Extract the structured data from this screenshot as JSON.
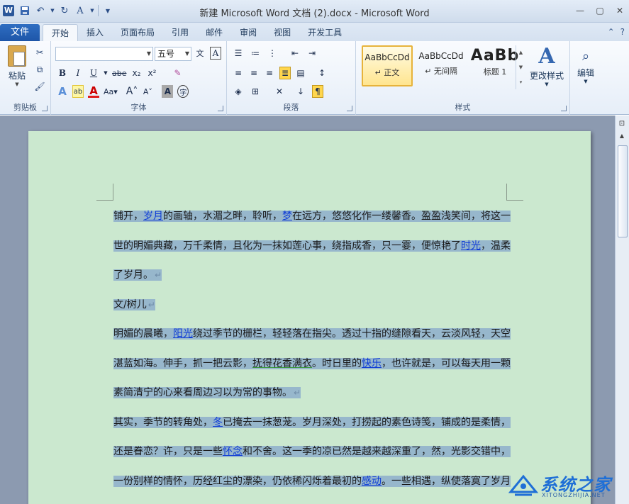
{
  "titlebar": {
    "title": "新建 Microsoft Word 文档 (2).docx - Microsoft Word",
    "logo_letter": "W"
  },
  "tabs": {
    "file": "文件",
    "items": [
      "开始",
      "插入",
      "页面布局",
      "引用",
      "邮件",
      "审阅",
      "视图",
      "开发工具"
    ],
    "active": "开始"
  },
  "ribbon": {
    "clipboard": {
      "label": "剪贴板",
      "paste": "粘贴"
    },
    "font": {
      "label": "字体",
      "font_name": "",
      "font_size": "五号",
      "buttons": [
        "B",
        "I",
        "U",
        "abe",
        "x₂",
        "x²"
      ]
    },
    "paragraph": {
      "label": "段落"
    },
    "styles": {
      "label": "样式",
      "items": [
        {
          "sample": "AaBbCcDd",
          "name": "↵ 正文",
          "selected": true
        },
        {
          "sample": "AaBbCcDd",
          "name": "↵ 无间隔",
          "selected": false
        },
        {
          "sample": "AaBb",
          "name": "标题 1",
          "selected": false
        }
      ],
      "change_styles": "更改样式"
    },
    "editing": {
      "label": "编辑"
    }
  },
  "document": {
    "lines": [
      {
        "segments": [
          {
            "t": "铺开，"
          },
          {
            "t": "岁月",
            "link": true
          },
          {
            "t": "的画轴，水湄之畔，聆听，"
          },
          {
            "t": "梦",
            "link": true
          },
          {
            "t": "在远方，悠悠化作一缕馨香。盈盈浅笑间，将这一"
          }
        ],
        "mark": false
      },
      {
        "segments": [
          {
            "t": "世的明媚典藏，万千柔情，且化为一抹如莲心事，绕指成香，只一霎，便惊艳了"
          },
          {
            "t": "时光",
            "link": true
          },
          {
            "t": "，温柔"
          }
        ],
        "mark": false
      },
      {
        "segments": [
          {
            "t": "了岁月。"
          }
        ],
        "mark": true
      },
      {
        "segments": [
          {
            "t": "文/树儿"
          }
        ],
        "mark": true
      },
      {
        "segments": [
          {
            "t": "明媚的晨曦，"
          },
          {
            "t": "阳光",
            "link": true
          },
          {
            "t": "绕过季节的栅栏，轻轻落在指尖。透过十指的缝隙看天，云淡风轻，天空"
          }
        ],
        "mark": false
      },
      {
        "segments": [
          {
            "t": "湛蓝如海。伸手，抓一把云影，"
          },
          {
            "t": "抚得花香满衣",
            "green": true
          },
          {
            "t": "。时日里的"
          },
          {
            "t": "快乐",
            "link": true
          },
          {
            "t": "，也许就是，可以每天用一颗"
          }
        ],
        "mark": false
      },
      {
        "segments": [
          {
            "t": "素简清宁的心来看周边习以为常的事物。"
          }
        ],
        "mark": true
      },
      {
        "segments": [
          {
            "t": "其实，季节的转角处，"
          },
          {
            "t": "冬",
            "link": true
          },
          {
            "t": "已掩去一抹葱茏。岁月深处，打捞起的素色诗笺，铺成的是柔情，"
          }
        ],
        "mark": false
      },
      {
        "segments": [
          {
            "t": "还是眷恋？许，只是一些"
          },
          {
            "t": "怀念",
            "link": true
          },
          {
            "t": "和不舍。这一季的凉已然是越来越深重了，然，光影交错中，"
          }
        ],
        "mark": false
      },
      {
        "segments": [
          {
            "t": "一份别样的情怀，历经红尘的漂染，仍依稀闪烁着最初的"
          },
          {
            "t": "感动",
            "link": true
          },
          {
            "t": "。一些相遇，纵使落寞了岁月"
          }
        ],
        "mark": false
      }
    ]
  },
  "watermark": {
    "main": "系统之家",
    "sub": "XITONGZHIJIA.NET"
  },
  "colors": {
    "page": "#cbe8cf",
    "selection": "#97b7cc",
    "link": "#0d3bd6",
    "file_tab": "#2b64b8"
  }
}
